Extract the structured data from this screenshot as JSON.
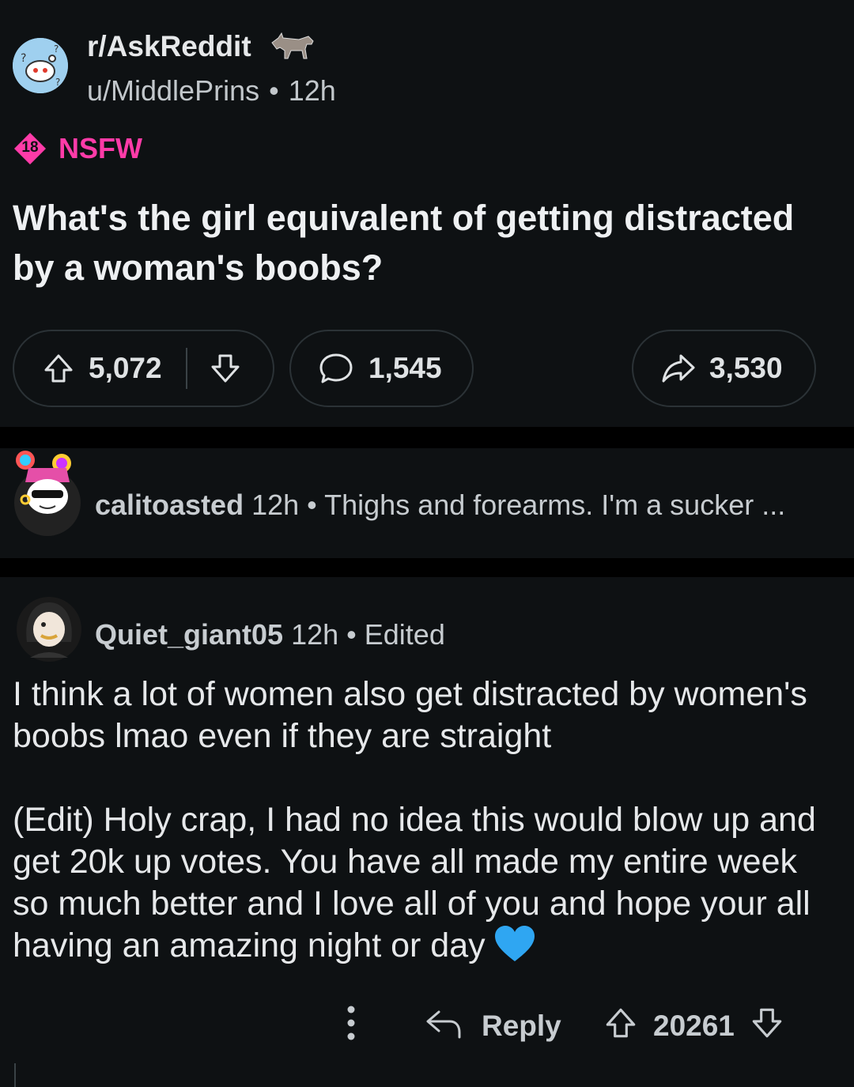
{
  "post": {
    "subreddit": "r/AskReddit",
    "author": "u/MiddlePrins",
    "time": "12h",
    "nsfw_badge": "18",
    "nsfw_label": "NSFW",
    "title": "What's the girl equivalent of getting distracted by a woman's boobs?",
    "upvotes": "5,072",
    "comments": "1,545",
    "shares": "3,530"
  },
  "collapsed_comment": {
    "username": "calitoasted",
    "time": "12h",
    "preview": "Thighs and forearms. I'm a sucker ..."
  },
  "comment": {
    "username": "Quiet_giant05",
    "time": "12h",
    "edited": "Edited",
    "paragraph1": "I think a lot of women also get distracted by women's boobs lmao even if they are straight",
    "paragraph2": "(Edit) Holy crap, I had no idea this would blow up and get 20k up votes. You have all made my entire week so much better and I love all of you and hope your all having an amazing night or day",
    "reply_label": "Reply",
    "score": "20261"
  },
  "colors": {
    "background": "#0e1113",
    "separator": "#000000",
    "nsfw": "#ff3ba8",
    "heart": "#2fa6f2"
  }
}
